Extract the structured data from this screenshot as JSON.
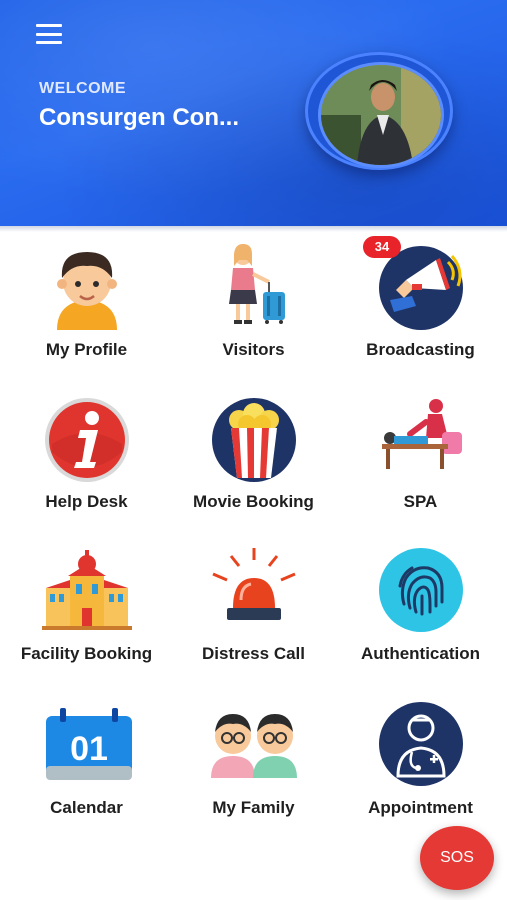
{
  "header": {
    "welcome": "WELCOME",
    "user_name": "Consurgen Con..."
  },
  "badges": {
    "broadcasting_count": "34"
  },
  "tiles": [
    {
      "label": "My Profile",
      "icon": "boy-avatar-icon"
    },
    {
      "label": "Visitors",
      "icon": "traveler-luggage-icon"
    },
    {
      "label": "Broadcasting",
      "icon": "megaphone-icon"
    },
    {
      "label": "Help Desk",
      "icon": "info-icon"
    },
    {
      "label": "Movie Booking",
      "icon": "popcorn-icon"
    },
    {
      "label": "SPA",
      "icon": "massage-icon"
    },
    {
      "label": "Facility Booking",
      "icon": "building-icon"
    },
    {
      "label": "Distress Call",
      "icon": "siren-icon"
    },
    {
      "label": "Authentication",
      "icon": "fingerprint-icon"
    },
    {
      "label": "Calendar",
      "icon": "calendar-icon",
      "calendar_day": "01"
    },
    {
      "label": "My Family",
      "icon": "family-icon"
    },
    {
      "label": "Appointment",
      "icon": "doctor-icon"
    }
  ],
  "fab": {
    "label": "SOS"
  },
  "colors": {
    "header_blue": "#1f62e8",
    "badge_red": "#e8232a",
    "sos_red": "#e53935"
  }
}
